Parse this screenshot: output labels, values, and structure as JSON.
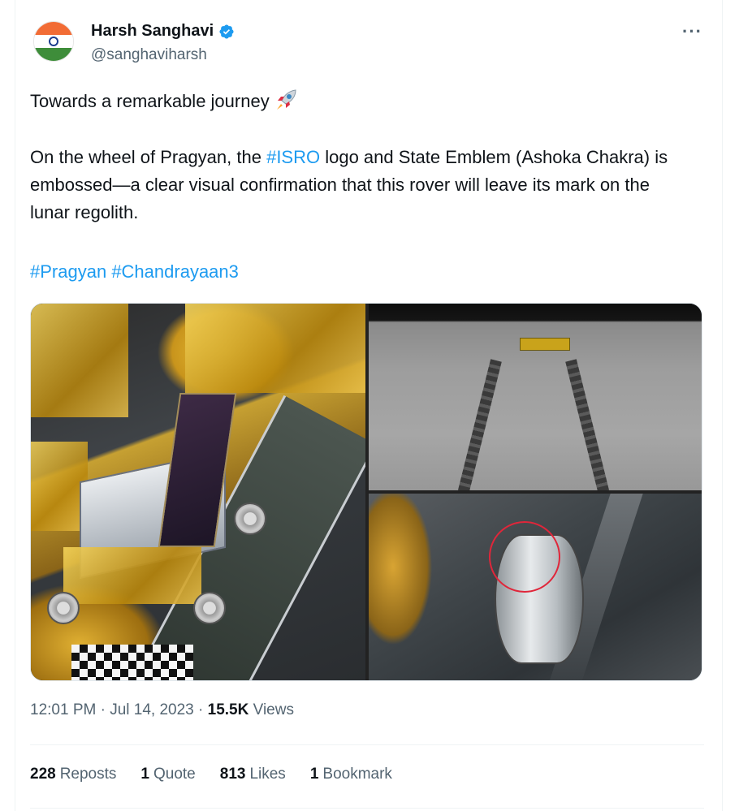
{
  "author": {
    "display_name": "Harsh Sanghavi",
    "handle": "@sanghaviharsh",
    "verified": true,
    "avatar": "india-flag-avatar"
  },
  "tweet": {
    "line1": "Towards  a remarkable journey",
    "line1_emoji": "rocket-emoji",
    "para_part1": "On the wheel of Pragyan, the ",
    "para_hashtag": "#ISRO",
    "para_part2": " logo and  State Emblem (Ashoka Chakra) is embossed—a clear visual confirmation that this rover will leave its mark on the lunar regolith.",
    "hashtags": [
      "#Pragyan",
      "#Chandrayaan3"
    ]
  },
  "media": [
    {
      "description": "rover-on-lander-ramp-photo"
    },
    {
      "description": "rover-tracks-on-lunar-soil-photo"
    },
    {
      "description": "rover-wheel-closeup-photo"
    }
  ],
  "meta": {
    "time": "12:01 PM",
    "date": "Jul 14, 2023",
    "separator": "·",
    "views_count": "15.5K",
    "views_label": "Views"
  },
  "stats": [
    {
      "count": "228",
      "label": "Reposts"
    },
    {
      "count": "1",
      "label": "Quote"
    },
    {
      "count": "813",
      "label": "Likes"
    },
    {
      "count": "1",
      "label": "Bookmark"
    }
  ],
  "colors": {
    "link": "#1d9bf0",
    "text": "#0f1419",
    "secondary": "#536471",
    "verified": "#1d9bf0"
  }
}
